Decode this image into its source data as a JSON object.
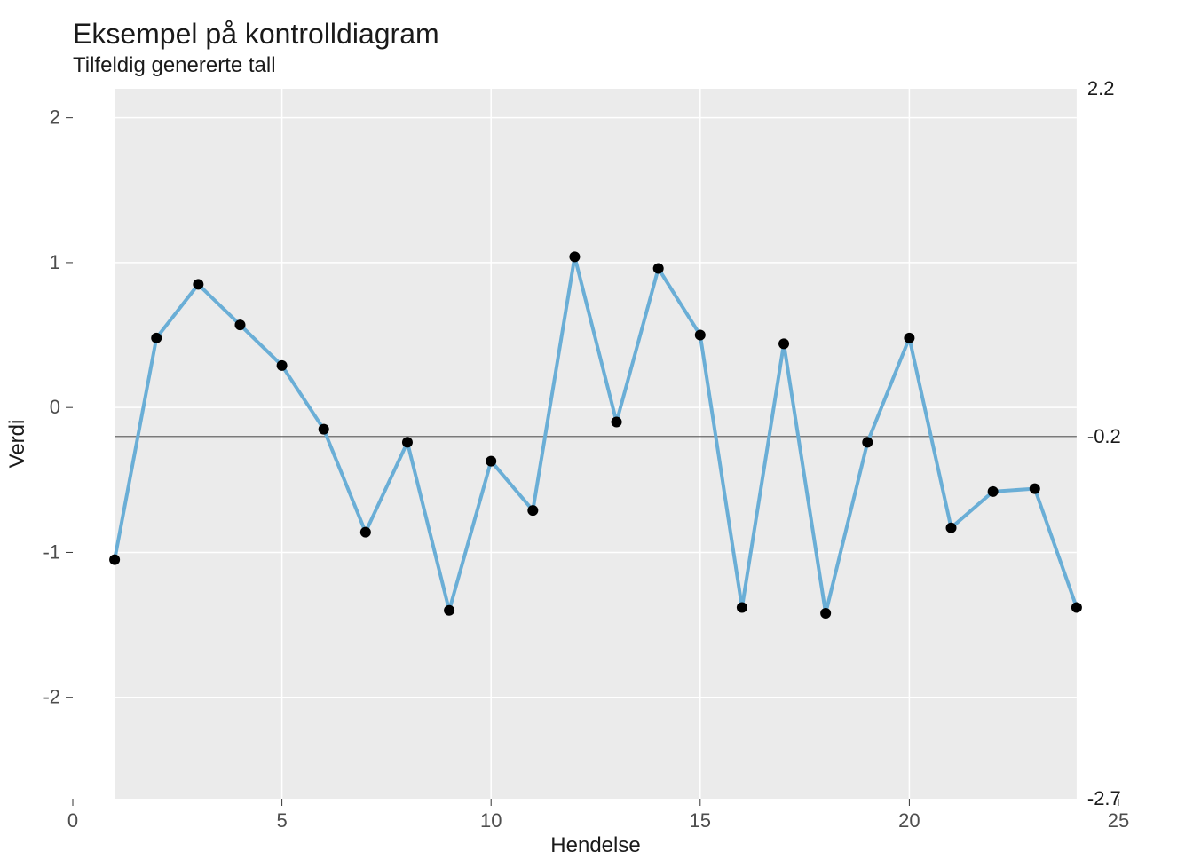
{
  "chart_data": {
    "type": "line",
    "title": "Eksempel på kontrolldiagram",
    "subtitle": "Tilfeldig genererte tall",
    "xlabel": "Hendelse",
    "ylabel": "Verdi",
    "x": [
      1,
      2,
      3,
      4,
      5,
      6,
      7,
      8,
      9,
      10,
      11,
      12,
      13,
      14,
      15,
      16,
      17,
      18,
      19,
      20,
      21,
      22,
      23,
      24
    ],
    "values": [
      -1.05,
      0.48,
      0.85,
      0.57,
      0.29,
      -0.15,
      -0.86,
      -0.24,
      -1.4,
      -0.37,
      -0.71,
      1.04,
      -0.1,
      0.96,
      0.5,
      -1.38,
      0.44,
      -1.42,
      -0.24,
      0.48,
      -0.83,
      -0.58,
      -0.56,
      -1.38
    ],
    "x_ticks": [
      0,
      5,
      10,
      15,
      20,
      25
    ],
    "y_ticks": [
      -2,
      -1,
      0,
      1,
      2
    ],
    "xlim": [
      0,
      25
    ],
    "ylim": [
      -2.7,
      2.2
    ],
    "reference_lines": [
      {
        "value": 2.2,
        "label": "2.2"
      },
      {
        "value": -0.2,
        "label": "-0.2"
      },
      {
        "value": -2.7,
        "label": "-2.7"
      }
    ],
    "line_color": "#6aaed6",
    "point_color": "#000000",
    "panel_bg": "#ebebeb"
  }
}
